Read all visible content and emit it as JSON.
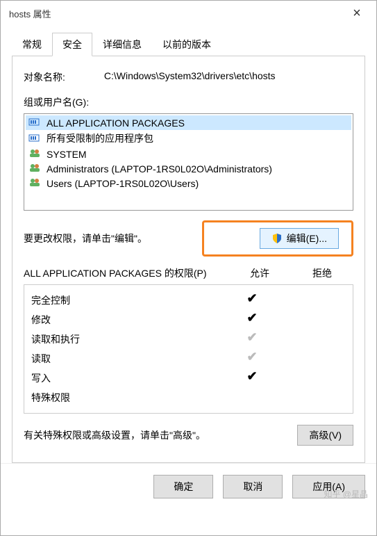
{
  "titlebar": {
    "title": "hosts 属性"
  },
  "tabs": {
    "t0": "常规",
    "t1": "安全",
    "t2": "详细信息",
    "t3": "以前的版本"
  },
  "objectName": {
    "label": "对象名称:",
    "value": "C:\\Windows\\System32\\drivers\\etc\\hosts"
  },
  "groupsLabel": "组或用户名(G):",
  "principals": {
    "p0": "ALL APPLICATION PACKAGES",
    "p1": "所有受限制的应用程序包",
    "p2": "SYSTEM",
    "p3": "Administrators (LAPTOP-1RS0L02O\\Administrators)",
    "p4": "Users (LAPTOP-1RS0L02O\\Users)"
  },
  "editHint": "要更改权限，请单击\"编辑\"。",
  "editBtn": "编辑(E)...",
  "permHeader": {
    "caption": "ALL APPLICATION PACKAGES 的权限(P)",
    "allow": "允许",
    "deny": "拒绝"
  },
  "perms": {
    "r0": "完全控制",
    "r1": "修改",
    "r2": "读取和执行",
    "r3": "读取",
    "r4": "写入",
    "r5": "特殊权限"
  },
  "advHint": "有关特殊权限或高级设置，请单击\"高级\"。",
  "advBtn": "高级(V)",
  "footer": {
    "ok": "确定",
    "cancel": "取消",
    "apply": "应用(A)"
  },
  "watermark": "知乎 @星晶"
}
